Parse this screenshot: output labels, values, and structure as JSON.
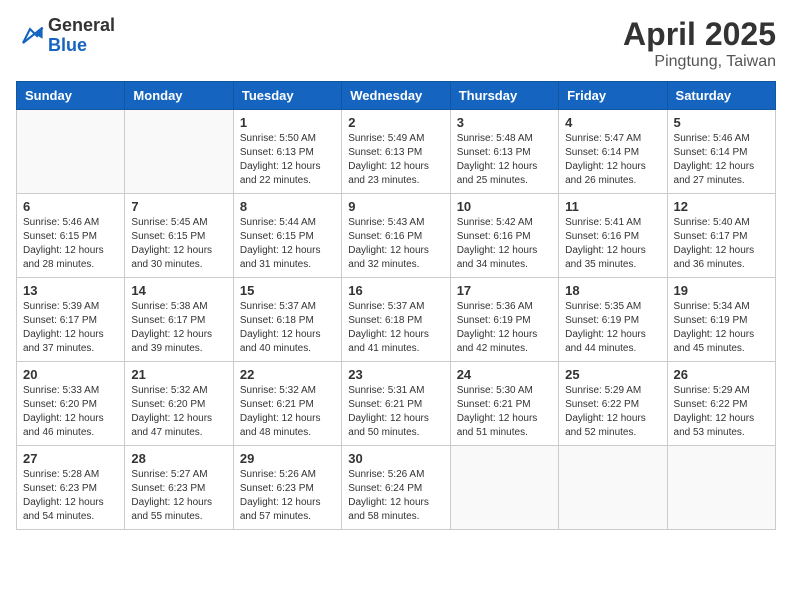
{
  "header": {
    "logo_general": "General",
    "logo_blue": "Blue",
    "title": "April 2025",
    "subtitle": "Pingtung, Taiwan"
  },
  "weekdays": [
    "Sunday",
    "Monday",
    "Tuesday",
    "Wednesday",
    "Thursday",
    "Friday",
    "Saturday"
  ],
  "weeks": [
    [
      {
        "day": "",
        "info": ""
      },
      {
        "day": "",
        "info": ""
      },
      {
        "day": "1",
        "info": "Sunrise: 5:50 AM\nSunset: 6:13 PM\nDaylight: 12 hours and 22 minutes."
      },
      {
        "day": "2",
        "info": "Sunrise: 5:49 AM\nSunset: 6:13 PM\nDaylight: 12 hours and 23 minutes."
      },
      {
        "day": "3",
        "info": "Sunrise: 5:48 AM\nSunset: 6:13 PM\nDaylight: 12 hours and 25 minutes."
      },
      {
        "day": "4",
        "info": "Sunrise: 5:47 AM\nSunset: 6:14 PM\nDaylight: 12 hours and 26 minutes."
      },
      {
        "day": "5",
        "info": "Sunrise: 5:46 AM\nSunset: 6:14 PM\nDaylight: 12 hours and 27 minutes."
      }
    ],
    [
      {
        "day": "6",
        "info": "Sunrise: 5:46 AM\nSunset: 6:15 PM\nDaylight: 12 hours and 28 minutes."
      },
      {
        "day": "7",
        "info": "Sunrise: 5:45 AM\nSunset: 6:15 PM\nDaylight: 12 hours and 30 minutes."
      },
      {
        "day": "8",
        "info": "Sunrise: 5:44 AM\nSunset: 6:15 PM\nDaylight: 12 hours and 31 minutes."
      },
      {
        "day": "9",
        "info": "Sunrise: 5:43 AM\nSunset: 6:16 PM\nDaylight: 12 hours and 32 minutes."
      },
      {
        "day": "10",
        "info": "Sunrise: 5:42 AM\nSunset: 6:16 PM\nDaylight: 12 hours and 34 minutes."
      },
      {
        "day": "11",
        "info": "Sunrise: 5:41 AM\nSunset: 6:16 PM\nDaylight: 12 hours and 35 minutes."
      },
      {
        "day": "12",
        "info": "Sunrise: 5:40 AM\nSunset: 6:17 PM\nDaylight: 12 hours and 36 minutes."
      }
    ],
    [
      {
        "day": "13",
        "info": "Sunrise: 5:39 AM\nSunset: 6:17 PM\nDaylight: 12 hours and 37 minutes."
      },
      {
        "day": "14",
        "info": "Sunrise: 5:38 AM\nSunset: 6:17 PM\nDaylight: 12 hours and 39 minutes."
      },
      {
        "day": "15",
        "info": "Sunrise: 5:37 AM\nSunset: 6:18 PM\nDaylight: 12 hours and 40 minutes."
      },
      {
        "day": "16",
        "info": "Sunrise: 5:37 AM\nSunset: 6:18 PM\nDaylight: 12 hours and 41 minutes."
      },
      {
        "day": "17",
        "info": "Sunrise: 5:36 AM\nSunset: 6:19 PM\nDaylight: 12 hours and 42 minutes."
      },
      {
        "day": "18",
        "info": "Sunrise: 5:35 AM\nSunset: 6:19 PM\nDaylight: 12 hours and 44 minutes."
      },
      {
        "day": "19",
        "info": "Sunrise: 5:34 AM\nSunset: 6:19 PM\nDaylight: 12 hours and 45 minutes."
      }
    ],
    [
      {
        "day": "20",
        "info": "Sunrise: 5:33 AM\nSunset: 6:20 PM\nDaylight: 12 hours and 46 minutes."
      },
      {
        "day": "21",
        "info": "Sunrise: 5:32 AM\nSunset: 6:20 PM\nDaylight: 12 hours and 47 minutes."
      },
      {
        "day": "22",
        "info": "Sunrise: 5:32 AM\nSunset: 6:21 PM\nDaylight: 12 hours and 48 minutes."
      },
      {
        "day": "23",
        "info": "Sunrise: 5:31 AM\nSunset: 6:21 PM\nDaylight: 12 hours and 50 minutes."
      },
      {
        "day": "24",
        "info": "Sunrise: 5:30 AM\nSunset: 6:21 PM\nDaylight: 12 hours and 51 minutes."
      },
      {
        "day": "25",
        "info": "Sunrise: 5:29 AM\nSunset: 6:22 PM\nDaylight: 12 hours and 52 minutes."
      },
      {
        "day": "26",
        "info": "Sunrise: 5:29 AM\nSunset: 6:22 PM\nDaylight: 12 hours and 53 minutes."
      }
    ],
    [
      {
        "day": "27",
        "info": "Sunrise: 5:28 AM\nSunset: 6:23 PM\nDaylight: 12 hours and 54 minutes."
      },
      {
        "day": "28",
        "info": "Sunrise: 5:27 AM\nSunset: 6:23 PM\nDaylight: 12 hours and 55 minutes."
      },
      {
        "day": "29",
        "info": "Sunrise: 5:26 AM\nSunset: 6:23 PM\nDaylight: 12 hours and 57 minutes."
      },
      {
        "day": "30",
        "info": "Sunrise: 5:26 AM\nSunset: 6:24 PM\nDaylight: 12 hours and 58 minutes."
      },
      {
        "day": "",
        "info": ""
      },
      {
        "day": "",
        "info": ""
      },
      {
        "day": "",
        "info": ""
      }
    ]
  ]
}
